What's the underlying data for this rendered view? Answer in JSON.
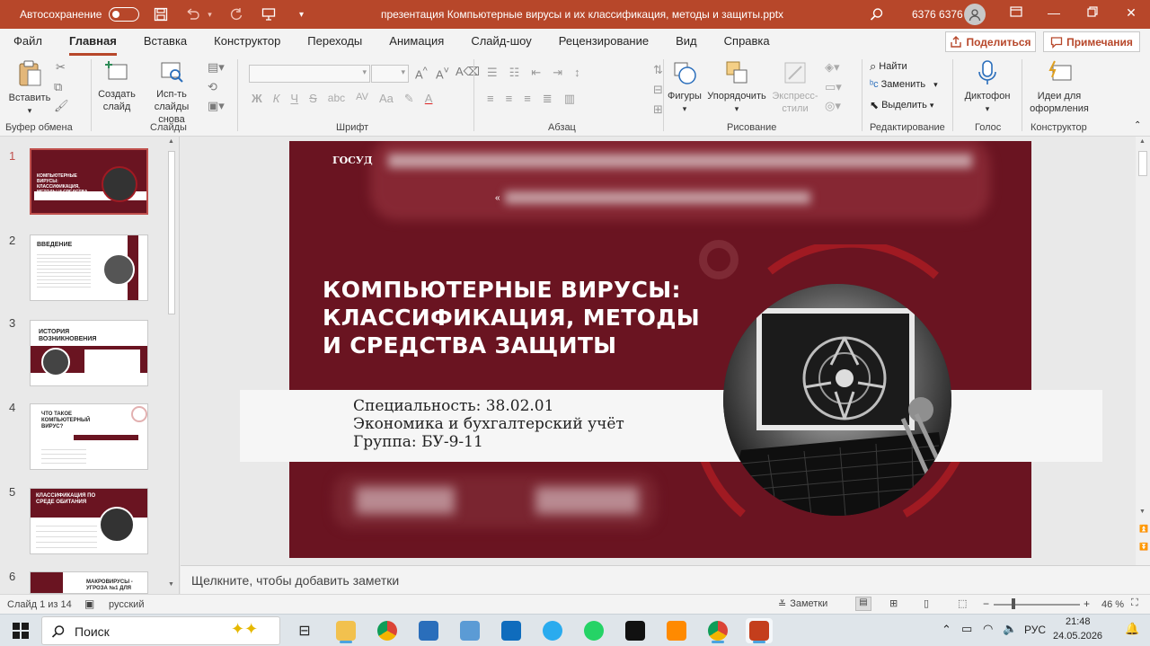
{
  "window": {
    "autosave_label": "Автосохранение",
    "doc_title": "презентация Компьютерные вирусы и их классификация, методы и защиты.pptx",
    "user": "6376 6376"
  },
  "tabs": [
    "Файл",
    "Главная",
    "Вставка",
    "Конструктор",
    "Переходы",
    "Анимация",
    "Слайд-шоу",
    "Рецензирование",
    "Вид",
    "Справка"
  ],
  "share_label": "Поделиться",
  "comments_label": "Примечания",
  "ribbon": {
    "clipboard": {
      "paste": "Вставить",
      "group": "Буфер обмена"
    },
    "slides": {
      "new_slide": "Создать слайд",
      "reuse": "Исп-ть слайды снова",
      "group": "Слайды"
    },
    "font": {
      "bold": "Ж",
      "italic": "К",
      "underline": "Ч",
      "strike": "S",
      "spacing": "AV",
      "case": "Aa",
      "group": "Шрифт"
    },
    "paragraph": {
      "group": "Абзац"
    },
    "drawing": {
      "shapes": "Фигуры",
      "arrange": "Упорядочить",
      "quick_styles": "Экспресс-стили",
      "group": "Рисование"
    },
    "editing": {
      "find": "Найти",
      "replace": "Заменить",
      "select": "Выделить",
      "group": "Редактирование"
    },
    "voice": {
      "dictate": "Диктофон",
      "group": "Голос"
    },
    "designer": {
      "ideas": "Идеи для оформления",
      "group": "Конструктор"
    }
  },
  "thumbnails": [
    {
      "num": "1",
      "title": "КОМПЬЮТЕРНЫЕ ВИРУСЫ: КЛАССИФИКАЦИЯ, МЕТОДЫ И СРЕДСТВА ЗАЩИТЫ"
    },
    {
      "num": "2",
      "title": "ВВЕДЕНИЕ"
    },
    {
      "num": "3",
      "title": "ИСТОРИЯ ВОЗНИКНОВЕНИЯ"
    },
    {
      "num": "4",
      "title": "ЧТО ТАКОЕ КОМПЬЮТЕРНЫЙ ВИРУС?"
    },
    {
      "num": "5",
      "title": "КЛАССИФИКАЦИЯ ПО СРЕДЕ ОБИТАНИЯ"
    },
    {
      "num": "6",
      "title": "МАКРОВИРУСЫ - УГРОЗА №1 ДЛЯ"
    }
  ],
  "slide": {
    "header_partial": "ГОСУД",
    "quote_mark": "«",
    "title_line1": "КОМПЬЮТЕРНЫЕ ВИРУСЫ:",
    "title_line2": "КЛАССИФИКАЦИЯ, МЕТОДЫ",
    "title_line3": "И СРЕДСТВА ЗАЩИТЫ",
    "info_line1": "Специальность: 38.02.01",
    "info_line2": "Экономика и бухгалтерский учёт",
    "info_line3": "Группа: БУ-9-11",
    "bg_color": "#6a1421",
    "accent_color": "#a01a22"
  },
  "notes_placeholder": "Щелкните, чтобы добавить заметки",
  "status": {
    "slide_counter": "Слайд 1 из 14",
    "language": "русский",
    "notes_btn": "Заметки",
    "zoom": "46 %"
  },
  "taskbar": {
    "search": "Поиск",
    "lang": "РУС",
    "time": "21:48",
    "date": "24.05.2026"
  }
}
